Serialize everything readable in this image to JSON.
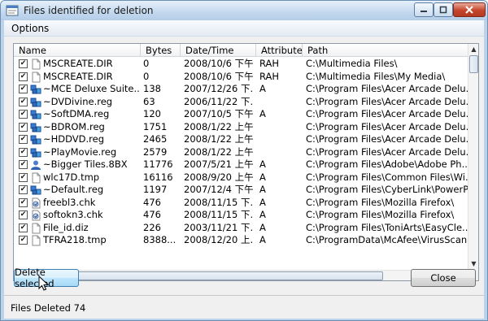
{
  "window": {
    "title": "Files identified for deletion"
  },
  "menu": {
    "options": "Options"
  },
  "columns": [
    "Name",
    "Bytes",
    "Date/Time",
    "Attribute",
    "Path"
  ],
  "rows": [
    {
      "checked": true,
      "icon": "blank-file-icon",
      "name": "MSCREATE.DIR",
      "bytes": "0",
      "date": "2008/10/6 下午...",
      "attr": "RAH",
      "path": "C:\\Multimedia Files\\"
    },
    {
      "checked": true,
      "icon": "blank-file-icon",
      "name": "MSCREATE.DIR",
      "bytes": "0",
      "date": "2008/10/6 下午...",
      "attr": "RAH",
      "path": "C:\\Multimedia Files\\My Media\\"
    },
    {
      "checked": true,
      "icon": "registry-file-icon",
      "name": "~MCE Deluxe Suite...",
      "bytes": "138",
      "date": "2007/12/26 下...",
      "attr": "A",
      "path": "C:\\Program Files\\Acer Arcade Delu..."
    },
    {
      "checked": true,
      "icon": "registry-file-icon",
      "name": "~DVDivine.reg",
      "bytes": "63",
      "date": "2006/11/22 下...",
      "attr": "",
      "path": "C:\\Program Files\\Acer Arcade Delu..."
    },
    {
      "checked": true,
      "icon": "registry-file-icon",
      "name": "~SoftDMA.reg",
      "bytes": "120",
      "date": "2007/10/5 下午...",
      "attr": "A",
      "path": "C:\\Program Files\\Acer Arcade Delu..."
    },
    {
      "checked": true,
      "icon": "registry-file-icon",
      "name": "~BDROM.reg",
      "bytes": "1751",
      "date": "2008/1/22 上午...",
      "attr": "",
      "path": "C:\\Program Files\\Acer Arcade Delu..."
    },
    {
      "checked": true,
      "icon": "registry-file-icon",
      "name": "~HDDVD.reg",
      "bytes": "2465",
      "date": "2008/1/22 上午...",
      "attr": "",
      "path": "C:\\Program Files\\Acer Arcade Delu..."
    },
    {
      "checked": true,
      "icon": "registry-file-icon",
      "name": "~PlayMovie.reg",
      "bytes": "2579",
      "date": "2008/1/22 上午...",
      "attr": "",
      "path": "C:\\Program Files\\Acer Arcade Delu..."
    },
    {
      "checked": true,
      "icon": "user-icon",
      "name": "~Bigger Tiles.8BX",
      "bytes": "11776",
      "date": "2007/5/21 上午...",
      "attr": "A",
      "path": "C:\\Program Files\\Adobe\\Adobe Ph..."
    },
    {
      "checked": true,
      "icon": "blank-file-icon",
      "name": "wlc17D.tmp",
      "bytes": "16116",
      "date": "2008/9/20 上午...",
      "attr": "A",
      "path": "C:\\Program Files\\Common Files\\Wi..."
    },
    {
      "checked": true,
      "icon": "registry-file-icon",
      "name": "~Default.reg",
      "bytes": "1197",
      "date": "2007/12/4 下午...",
      "attr": "A",
      "path": "C:\\Program Files\\CyberLink\\PowerP..."
    },
    {
      "checked": true,
      "icon": "chk-file-icon",
      "name": "freebl3.chk",
      "bytes": "476",
      "date": "2008/11/15 下...",
      "attr": "A",
      "path": "C:\\Program Files\\Mozilla Firefox\\"
    },
    {
      "checked": true,
      "icon": "chk-file-icon",
      "name": "softokn3.chk",
      "bytes": "476",
      "date": "2008/11/15 下...",
      "attr": "A",
      "path": "C:\\Program Files\\Mozilla Firefox\\"
    },
    {
      "checked": true,
      "icon": "blank-file-icon",
      "name": "File_id.diz",
      "bytes": "226",
      "date": "2003/11/21 下...",
      "attr": "A",
      "path": "C:\\Program Files\\ToniArts\\EasyCle..."
    },
    {
      "checked": true,
      "icon": "blank-file-icon",
      "name": "TFRA218.tmp",
      "bytes": "8388...",
      "date": "2008/12/20 上...",
      "attr": "A",
      "path": "C:\\ProgramData\\McAfee\\VirusScan..."
    }
  ],
  "buttons": {
    "delete_selected": "Delete selected",
    "close": "Close"
  },
  "status": {
    "text": "Files Deleted 74"
  },
  "colors": {
    "accent": "#3c7fb1",
    "titlebar": "#c3d8ee",
    "close": "#c6452b"
  }
}
